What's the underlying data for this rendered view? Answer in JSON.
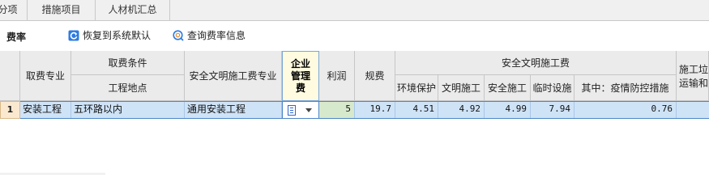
{
  "tabs": [
    "分项",
    "措施项目",
    "人材机汇总"
  ],
  "toolbar": {
    "title": "费率",
    "restore_label": "恢复到系统默认",
    "query_label": "查询费率信息"
  },
  "headers": {
    "fee_major": "取费专业",
    "fee_condition": "取费条件",
    "project_location": "工程地点",
    "safety_major": "安全文明施工费专业",
    "enterprise_mgmt": "企业管理费",
    "profit": "利润",
    "regulation_fee": "规费",
    "safety_group": "安全文明施工费",
    "env_protection": "环境保护",
    "civil_construction": "文明施工",
    "safe_construction": "安全施工",
    "temp_facilities": "临时设施",
    "epidemic": "其中：疫情防控措施",
    "waste_transport_line1": "施工垃",
    "waste_transport_line2": "运输和"
  },
  "rows": [
    {
      "index": "1",
      "fee_major": "安装工程",
      "location": "五环路以内",
      "safety_major": "通用安装工程",
      "profit": "5",
      "regulation_fee": "19.7",
      "env_protection": "4.51",
      "civil_construction": "4.92",
      "safe_construction": "4.99",
      "temp_facilities": "7.94",
      "epidemic": "0.76"
    }
  ],
  "colors": {
    "accent": "#4a86c8",
    "row_selected": "#cfe3f7",
    "header_bg": "#ebebeb",
    "profit_cell": "#d7e9cc"
  }
}
